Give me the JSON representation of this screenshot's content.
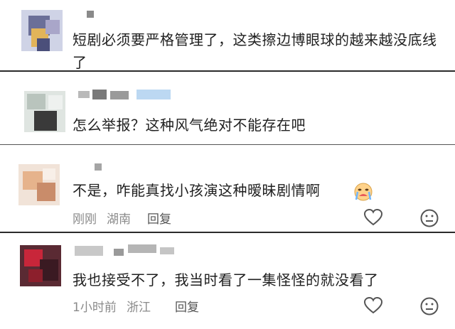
{
  "comments": [
    {
      "text": "短剧必须要严格管理了，这类擦边博眼球的越来越没底线了",
      "time": "",
      "location": "",
      "reply_label": ""
    },
    {
      "text": "怎么举报？这种风气绝对不能存在吧",
      "time": "",
      "location": "",
      "reply_label": ""
    },
    {
      "text": "不是，咋能真找小孩演这种暧昧剧情啊",
      "time": "刚刚",
      "location": "湖南",
      "reply_label": "回复"
    },
    {
      "text": "我也接受不了，我当时看了一集怪怪的就没看了",
      "time": "1小时前",
      "location": "浙江",
      "reply_label": "回复"
    }
  ],
  "icons": {
    "like": "heart-outline-icon",
    "react": "neutral-face-icon",
    "diamond": "diamond-badge-icon",
    "emoji": "crying-face-emoji"
  },
  "colors": {
    "meta": "#8a8a8a",
    "divider": "#2b2b2b",
    "diamond": "#6fa3e6"
  }
}
